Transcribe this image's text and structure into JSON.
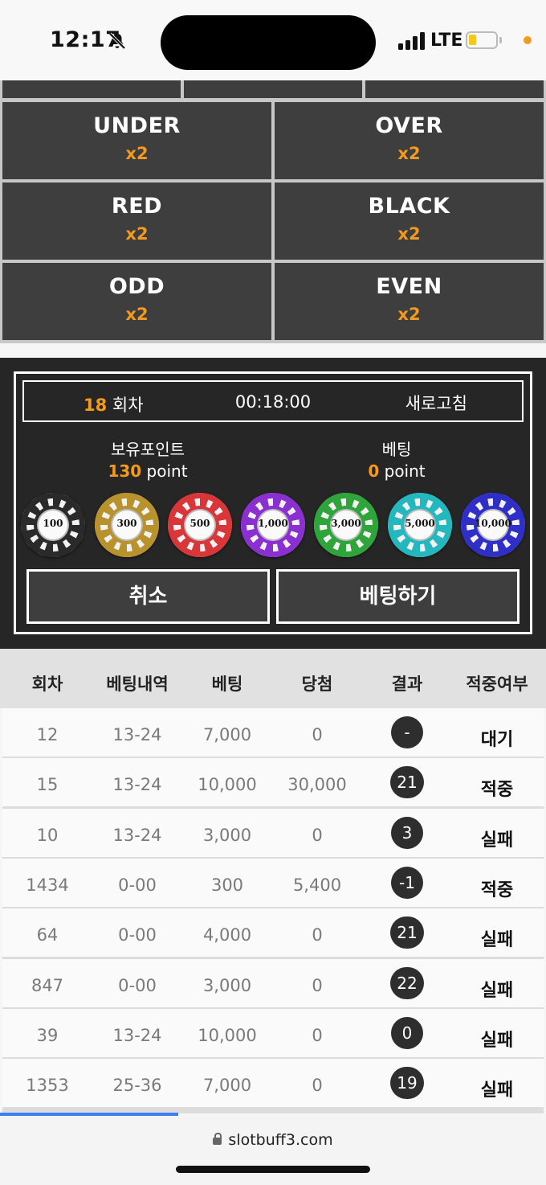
{
  "status": {
    "time": "12:17",
    "network": "LTE",
    "battery_color": "#f3c91e"
  },
  "grid": [
    {
      "name": "UNDER",
      "mult": "x2"
    },
    {
      "name": "OVER",
      "mult": "x2"
    },
    {
      "name": "RED",
      "mult": "x2"
    },
    {
      "name": "BLACK",
      "mult": "x2"
    },
    {
      "name": "ODD",
      "mult": "x2"
    },
    {
      "name": "EVEN",
      "mult": "x2"
    }
  ],
  "panel": {
    "round_number": "18",
    "round_suffix": " 회차",
    "timer": "00:18:00",
    "refresh": "새로고침",
    "holding_label": "보유포인트",
    "holding_value": "130",
    "bet_label": "베팅",
    "bet_value": "0",
    "point_unit": " point",
    "chips": [
      {
        "label": "100",
        "color": "#2a2a2a"
      },
      {
        "label": "300",
        "color": "#b8922c"
      },
      {
        "label": "500",
        "color": "#d9363a"
      },
      {
        "label": "1,000",
        "color": "#8a2fd0"
      },
      {
        "label": "3,000",
        "color": "#2ea43b"
      },
      {
        "label": "5,000",
        "color": "#24b7bd"
      },
      {
        "label": "10,000",
        "color": "#2f2fc8"
      }
    ],
    "cancel": "취소",
    "submit": "베팅하기"
  },
  "table": {
    "headers": [
      "회차",
      "베팅내역",
      "베팅",
      "당첨",
      "결과",
      "적중여부"
    ],
    "rows": [
      {
        "round": "12",
        "pick": "13-24",
        "bet": "7,000",
        "win": "0",
        "result": "-",
        "status": "대기"
      },
      {
        "round": "15",
        "pick": "13-24",
        "bet": "10,000",
        "win": "30,000",
        "result": "21",
        "status": "적중"
      },
      {
        "round": "10",
        "pick": "13-24",
        "bet": "3,000",
        "win": "0",
        "result": "3",
        "status": "실패"
      },
      {
        "round": "1434",
        "pick": "0-00",
        "bet": "300",
        "win": "5,400",
        "result": "-1",
        "status": "적중"
      },
      {
        "round": "64",
        "pick": "0-00",
        "bet": "4,000",
        "win": "0",
        "result": "21",
        "status": "실패"
      },
      {
        "round": "847",
        "pick": "0-00",
        "bet": "3,000",
        "win": "0",
        "result": "22",
        "status": "실패"
      },
      {
        "round": "39",
        "pick": "13-24",
        "bet": "10,000",
        "win": "0",
        "result": "0",
        "status": "실패"
      },
      {
        "round": "1353",
        "pick": "25-36",
        "bet": "7,000",
        "win": "0",
        "result": "19",
        "status": "실패"
      }
    ]
  },
  "browser": {
    "url": "slotbuff3.com",
    "accent": "#3d7ef2"
  }
}
